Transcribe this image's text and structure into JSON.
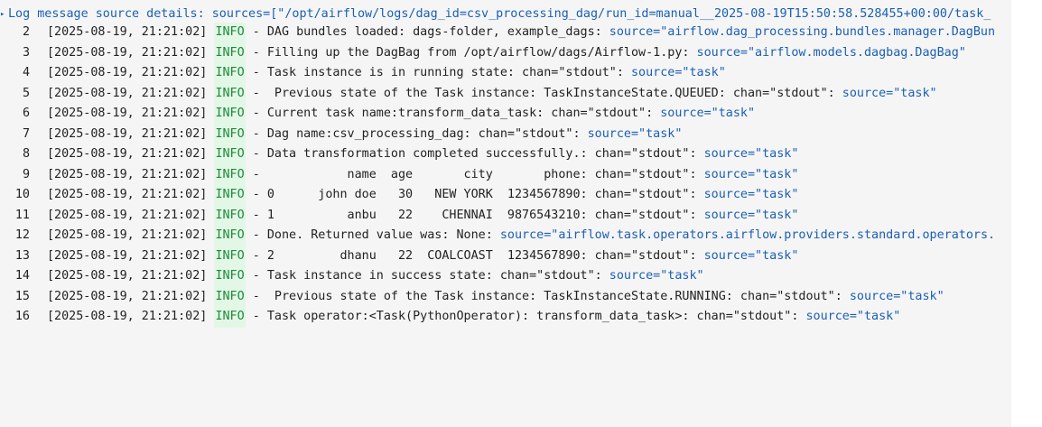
{
  "header": {
    "text": "Log message source details: sources=[\"/opt/airflow/logs/dag_id=csv_processing_dag/run_id=manual__2025-08-19T15:50:58.528455+00:00/task_"
  },
  "lines": [
    {
      "no": "2",
      "ts": "[2025-08-19, 21:21:02]",
      "level": "INFO",
      "msg": " - DAG bundles loaded: dags-folder, example_dags: ",
      "source": "source=\"airflow.dag_processing.bundles.manager.DagBun"
    },
    {
      "no": "3",
      "ts": "[2025-08-19, 21:21:02]",
      "level": "INFO",
      "msg": " - Filling up the DagBag from /opt/airflow/dags/Airflow-1.py: ",
      "source": "source=\"airflow.models.dagbag.DagBag\""
    },
    {
      "no": "4",
      "ts": "[2025-08-19, 21:21:02]",
      "level": "INFO",
      "msg": " - Task instance is in running state: chan=\"stdout\": ",
      "source": "source=\"task\""
    },
    {
      "no": "5",
      "ts": "[2025-08-19, 21:21:02]",
      "level": "INFO",
      "msg": " -  Previous state of the Task instance: TaskInstanceState.QUEUED: chan=\"stdout\": ",
      "source": "source=\"task\""
    },
    {
      "no": "6",
      "ts": "[2025-08-19, 21:21:02]",
      "level": "INFO",
      "msg": " - Current task name:transform_data_task: chan=\"stdout\": ",
      "source": "source=\"task\""
    },
    {
      "no": "7",
      "ts": "[2025-08-19, 21:21:02]",
      "level": "INFO",
      "msg": " - Dag name:csv_processing_dag: chan=\"stdout\": ",
      "source": "source=\"task\""
    },
    {
      "no": "8",
      "ts": "[2025-08-19, 21:21:02]",
      "level": "INFO",
      "msg": " - Data transformation completed successfully.: chan=\"stdout\": ",
      "source": "source=\"task\""
    },
    {
      "no": "9",
      "ts": "[2025-08-19, 21:21:02]",
      "level": "INFO",
      "msg": " -            name  age       city       phone: chan=\"stdout\": ",
      "source": "source=\"task\""
    },
    {
      "no": "10",
      "ts": "[2025-08-19, 21:21:02]",
      "level": "INFO",
      "msg": " - 0      john doe   30   NEW YORK  1234567890: chan=\"stdout\": ",
      "source": "source=\"task\""
    },
    {
      "no": "11",
      "ts": "[2025-08-19, 21:21:02]",
      "level": "INFO",
      "msg": " - 1          anbu   22    CHENNAI  9876543210: chan=\"stdout\": ",
      "source": "source=\"task\""
    },
    {
      "no": "12",
      "ts": "[2025-08-19, 21:21:02]",
      "level": "INFO",
      "msg": " - Done. Returned value was: None: ",
      "source": "source=\"airflow.task.operators.airflow.providers.standard.operators."
    },
    {
      "no": "13",
      "ts": "[2025-08-19, 21:21:02]",
      "level": "INFO",
      "msg": " - 2         dhanu   22  COALCOAST  1234567890: chan=\"stdout\": ",
      "source": "source=\"task\""
    },
    {
      "no": "14",
      "ts": "[2025-08-19, 21:21:02]",
      "level": "INFO",
      "msg": " - Task instance in success state: chan=\"stdout\": ",
      "source": "source=\"task\""
    },
    {
      "no": "15",
      "ts": "[2025-08-19, 21:21:02]",
      "level": "INFO",
      "msg": " -  Previous state of the Task instance: TaskInstanceState.RUNNING: chan=\"stdout\": ",
      "source": "source=\"task\""
    },
    {
      "no": "16",
      "ts": "[2025-08-19, 21:21:02]",
      "level": "INFO",
      "msg": " - Task operator:<Task(PythonOperator): transform_data_task>: chan=\"stdout\": ",
      "source": "source=\"task\""
    }
  ]
}
